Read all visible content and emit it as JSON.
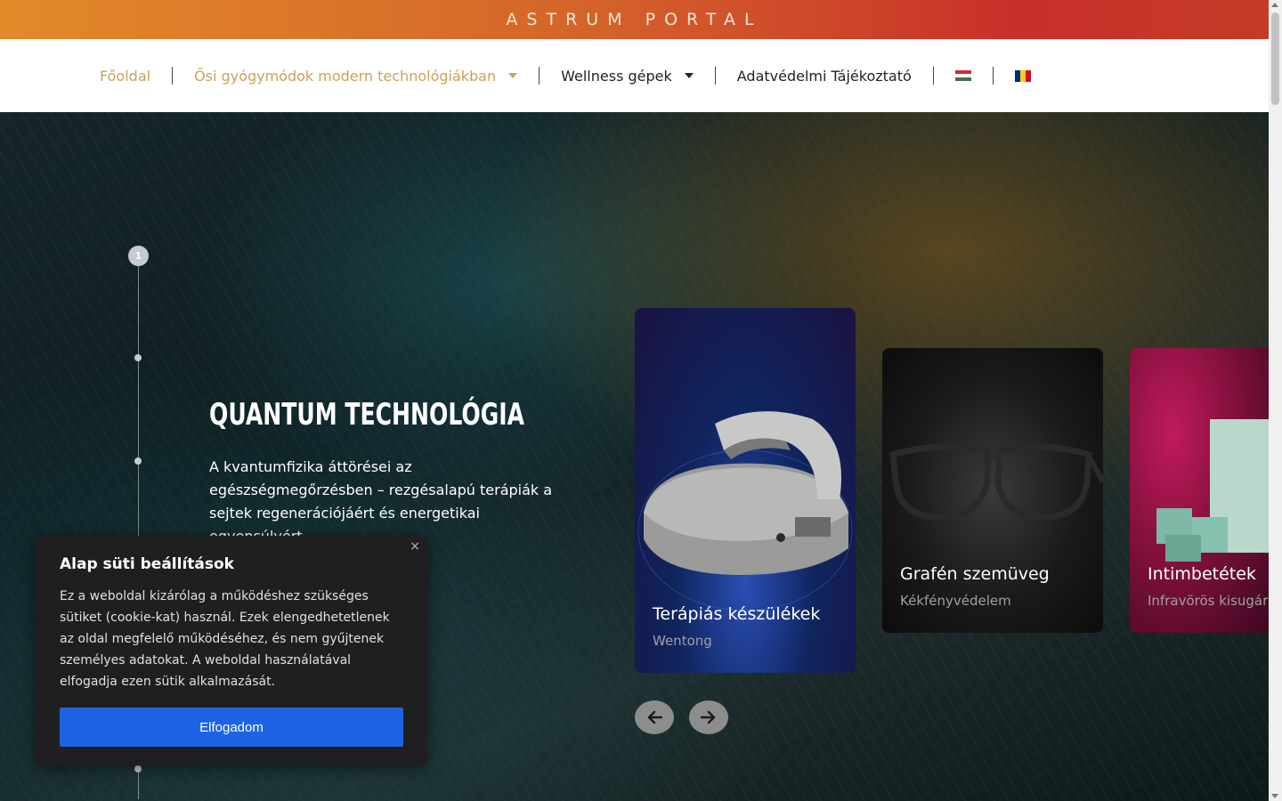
{
  "header": {
    "brand": "ASTRUM PORTAL"
  },
  "nav": {
    "items": [
      {
        "label": "Főoldal",
        "active": true
      },
      {
        "label": "Ősi gyógymódok modern technológiákban",
        "has_dropdown": true,
        "active": true
      },
      {
        "label": "Wellness gépek",
        "has_dropdown": true
      },
      {
        "label": "Adatvédelmi Tájékoztató"
      }
    ],
    "flags": [
      "hungarian-flag",
      "romanian-flag"
    ],
    "colors": {
      "accent": "#c9a25a"
    }
  },
  "hero": {
    "step_number": "1",
    "title": "QUANTUM TECHNOLÓGIA",
    "description": "A kvantumfizika áttörései az egészségmegőrzésben – rezgésalapú terápiák a sejtek regenerációjáért és energetikai egyensúlyért"
  },
  "cards": [
    {
      "title": "Terápiás készülékek",
      "subtitle": "Wentong"
    },
    {
      "title": "Grafén szemüveg",
      "subtitle": "Kékfényvédelem"
    },
    {
      "title": "Intimbetétek",
      "subtitle": "Infravörös kisugárzás"
    }
  ],
  "cookie": {
    "title": "Alap süti beállítások",
    "text": "Ez a weboldal kizárólag a működéshez szükséges sütiket (cookie-kat) használ. Ezek elengedhetetlenek az oldal megfelelő működéséhez, és nem gyűjtenek személyes adatokat. A weboldal használatával elfogadja ezen sütik alkalmazását.",
    "accept_label": "Elfogadom",
    "close_label": "×"
  }
}
